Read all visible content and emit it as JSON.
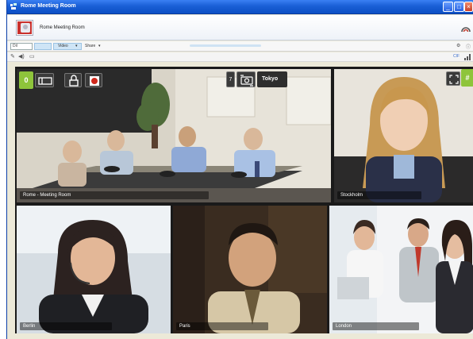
{
  "window": {
    "title": "Rome Meeting Room",
    "controls": [
      "minimize",
      "maximize",
      "close"
    ]
  },
  "header": {
    "room_name": "Rome Meeting Room",
    "signal_icon": "signal-strength-icon"
  },
  "menubar": {
    "search_text": "Dil",
    "items": [
      "Video",
      "Share"
    ],
    "right_icons": [
      "settings-icon",
      "info-icon"
    ]
  },
  "toolbar": {
    "icons": [
      "pencil-icon",
      "speaker-icon",
      "chat-icon"
    ],
    "right_label": "CIF",
    "right_icons": [
      "bars-icon"
    ]
  },
  "video_tiles": [
    {
      "id": "rome",
      "caption": "Rome - Meeting Room"
    },
    {
      "id": "stockholm",
      "caption": "Stockholm"
    },
    {
      "id": "berlin",
      "caption": "Berlin"
    },
    {
      "id": "paris",
      "caption": "Paris"
    },
    {
      "id": "london",
      "caption": "London"
    }
  ],
  "overlay": {
    "participant_count": "0",
    "remote_city": "Tokyo",
    "remote_index": "7"
  },
  "colors": {
    "titlebar": "#1a5fd6",
    "accent_green": "#8ec43b",
    "tile_border": "#1a1a1a"
  }
}
